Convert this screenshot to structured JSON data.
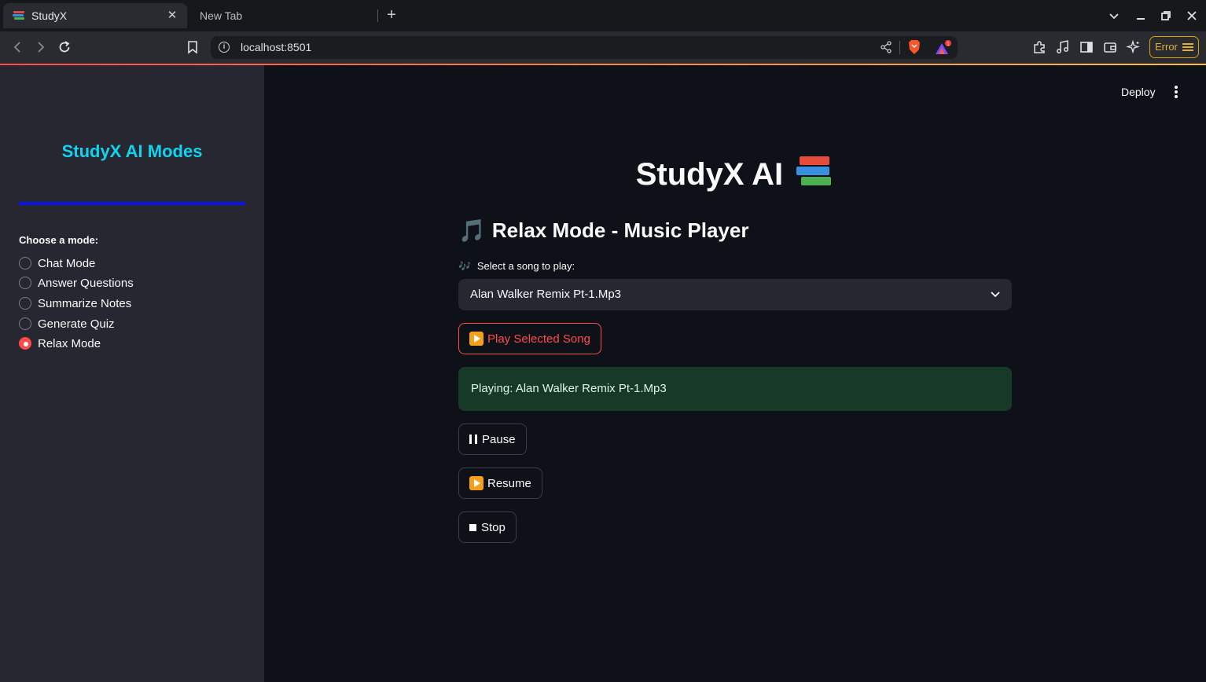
{
  "browser": {
    "tabs": [
      {
        "title": "StudyX"
      },
      {
        "title": "New Tab"
      }
    ],
    "url": "localhost:8501",
    "error_label": "Error",
    "notification_count": "1"
  },
  "sidebar": {
    "title": "StudyX AI Modes",
    "rule_color": "#0a16e8",
    "radio_label": "Choose a mode:",
    "modes": [
      {
        "label": "Chat Mode",
        "selected": false
      },
      {
        "label": "Answer Questions",
        "selected": false
      },
      {
        "label": "Summarize Notes",
        "selected": false
      },
      {
        "label": "Generate Quiz",
        "selected": false
      },
      {
        "label": "Relax Mode",
        "selected": true
      }
    ]
  },
  "header": {
    "deploy_label": "Deploy"
  },
  "main": {
    "title": "StudyX AI",
    "title_emoji": "books-emoji",
    "section_header": "Relax Mode - Music Player",
    "section_icon": "🎵",
    "select_label": "Select a song to play:",
    "select_icon": "🎶",
    "selected_song": "Alan Walker Remix Pt-1.Mp3",
    "play_button": "Play Selected Song",
    "status_message": "Playing: Alan Walker Remix Pt-1.Mp3",
    "pause_button": "Pause",
    "resume_button": "Resume",
    "stop_button": "Stop"
  },
  "colors": {
    "accent": "#ff4b4b",
    "sidebar_title": "#10d3f0",
    "success_bg": "#173928",
    "main_bg": "#0e1117",
    "sidebar_bg": "#262730"
  }
}
